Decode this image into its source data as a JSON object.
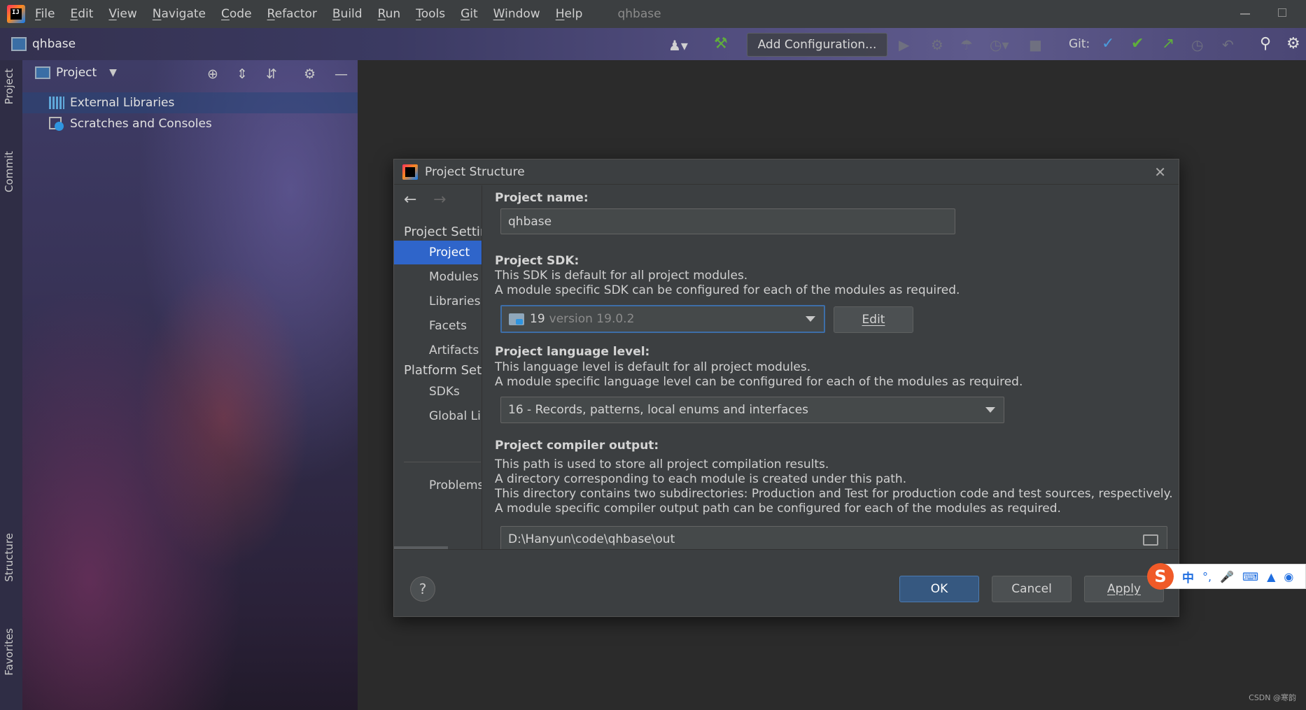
{
  "menubar": {
    "items": [
      "File",
      "Edit",
      "View",
      "Navigate",
      "Code",
      "Refactor",
      "Build",
      "Run",
      "Tools",
      "Git",
      "Window",
      "Help"
    ],
    "window_title": "qhbase",
    "logo_text": "IJ"
  },
  "toolbar": {
    "project_name": "qhbase",
    "add_configuration_label": "Add Configuration...",
    "git_label": "Git:"
  },
  "sidebar": {
    "vertical_tabs": [
      "Project",
      "Commit",
      "Structure",
      "Favorites"
    ]
  },
  "project_panel": {
    "title": "Project",
    "tree": [
      "External Libraries",
      "Scratches and Consoles"
    ]
  },
  "dialog": {
    "title": "Project Structure",
    "nav": {
      "project_settings_header": "Project Settir",
      "project_settings_items": [
        "Project",
        "Modules",
        "Libraries",
        "Facets",
        "Artifacts"
      ],
      "platform_settings_header": "Platform Sett",
      "platform_settings_items": [
        "SDKs",
        "Global Li"
      ],
      "problems_label": "Problems",
      "selected": "Project"
    },
    "project_name_label": "Project name:",
    "project_name_value": "qhbase",
    "sdk": {
      "label": "Project SDK:",
      "desc_1": "This SDK is default for all project modules.",
      "desc_2": "A module specific SDK can be configured for each of the modules as required.",
      "selected_num": "19",
      "selected_version": "version 19.0.2",
      "edit_label": "Edit"
    },
    "language_level": {
      "label": "Project language level:",
      "desc_1": "This language level is default for all project modules.",
      "desc_2": "A module specific language level can be configured for each of the modules as required.",
      "selected": "16 - Records, patterns, local enums and interfaces"
    },
    "compiler_output": {
      "label": "Project compiler output:",
      "desc_1": "This path is used to store all project compilation results.",
      "desc_2": "A directory corresponding to each module is created under this path.",
      "desc_3": "This directory contains two subdirectories: Production and Test for production code and test sources, respectively.",
      "desc_4": "A module specific compiler output path can be configured for each of the modules as required.",
      "path": "D:\\Hanyun\\code\\qhbase\\out"
    },
    "buttons": {
      "help": "?",
      "ok": "OK",
      "cancel": "Cancel",
      "apply": "Apply"
    }
  },
  "ime": {
    "logo": "S",
    "mode": "中"
  },
  "watermark": "CSDN @寒韵"
}
